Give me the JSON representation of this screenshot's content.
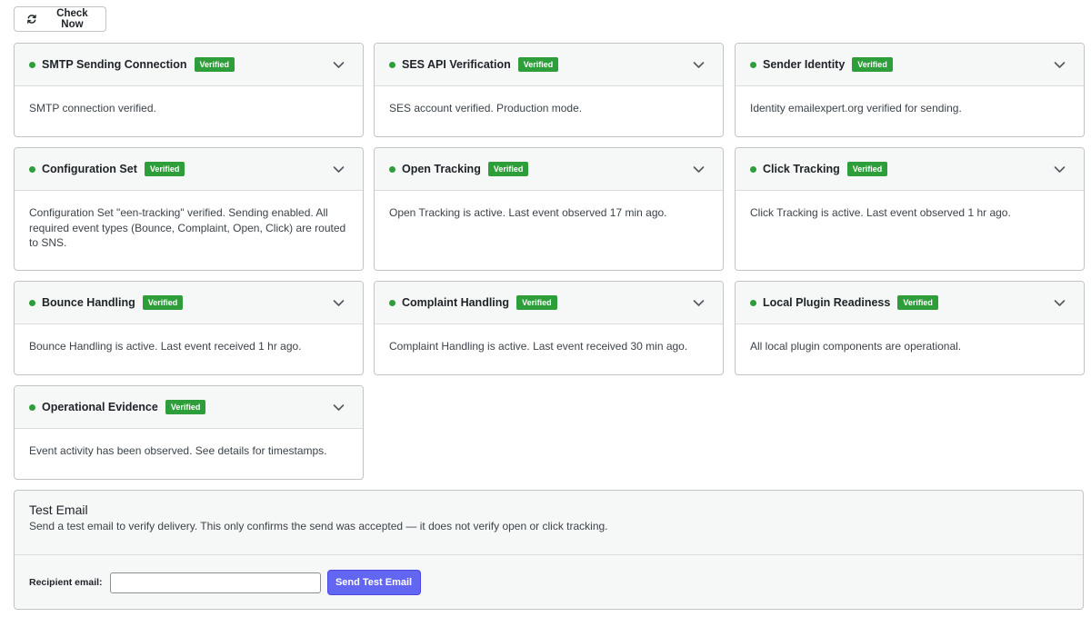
{
  "toolbar": {
    "check_now_label": "Check Now"
  },
  "colors": {
    "verified_green": "#2e9e3b",
    "primary_button": "#6366f1"
  },
  "cards": [
    {
      "title": "SMTP Sending Connection",
      "badge": "Verified",
      "body": "SMTP connection verified."
    },
    {
      "title": "SES API Verification",
      "badge": "Verified",
      "body": "SES account verified. Production mode."
    },
    {
      "title": "Sender Identity",
      "badge": "Verified",
      "body": "Identity emailexpert.org verified for sending."
    },
    {
      "title": "Configuration Set",
      "badge": "Verified",
      "body": "Configuration Set \"een-tracking\" verified. Sending enabled. All required event types (Bounce, Complaint, Open, Click) are routed to SNS."
    },
    {
      "title": "Open Tracking",
      "badge": "Verified",
      "body": "Open Tracking is active. Last event observed 17 min ago."
    },
    {
      "title": "Click Tracking",
      "badge": "Verified",
      "body": "Click Tracking is active. Last event observed 1 hr ago."
    },
    {
      "title": "Bounce Handling",
      "badge": "Verified",
      "body": "Bounce Handling is active. Last event received 1 hr ago."
    },
    {
      "title": "Complaint Handling",
      "badge": "Verified",
      "body": "Complaint Handling is active. Last event received 30 min ago."
    },
    {
      "title": "Local Plugin Readiness",
      "badge": "Verified",
      "body": "All local plugin components are operational."
    },
    {
      "title": "Operational Evidence",
      "badge": "Verified",
      "body": "Event activity has been observed. See details for timestamps."
    }
  ],
  "test_email": {
    "title": "Test Email",
    "description": "Send a test email to verify delivery. This only confirms the send was accepted — it does not verify open or click tracking.",
    "recipient_label": "Recipient email:",
    "recipient_value": "",
    "send_label": "Send Test Email"
  }
}
